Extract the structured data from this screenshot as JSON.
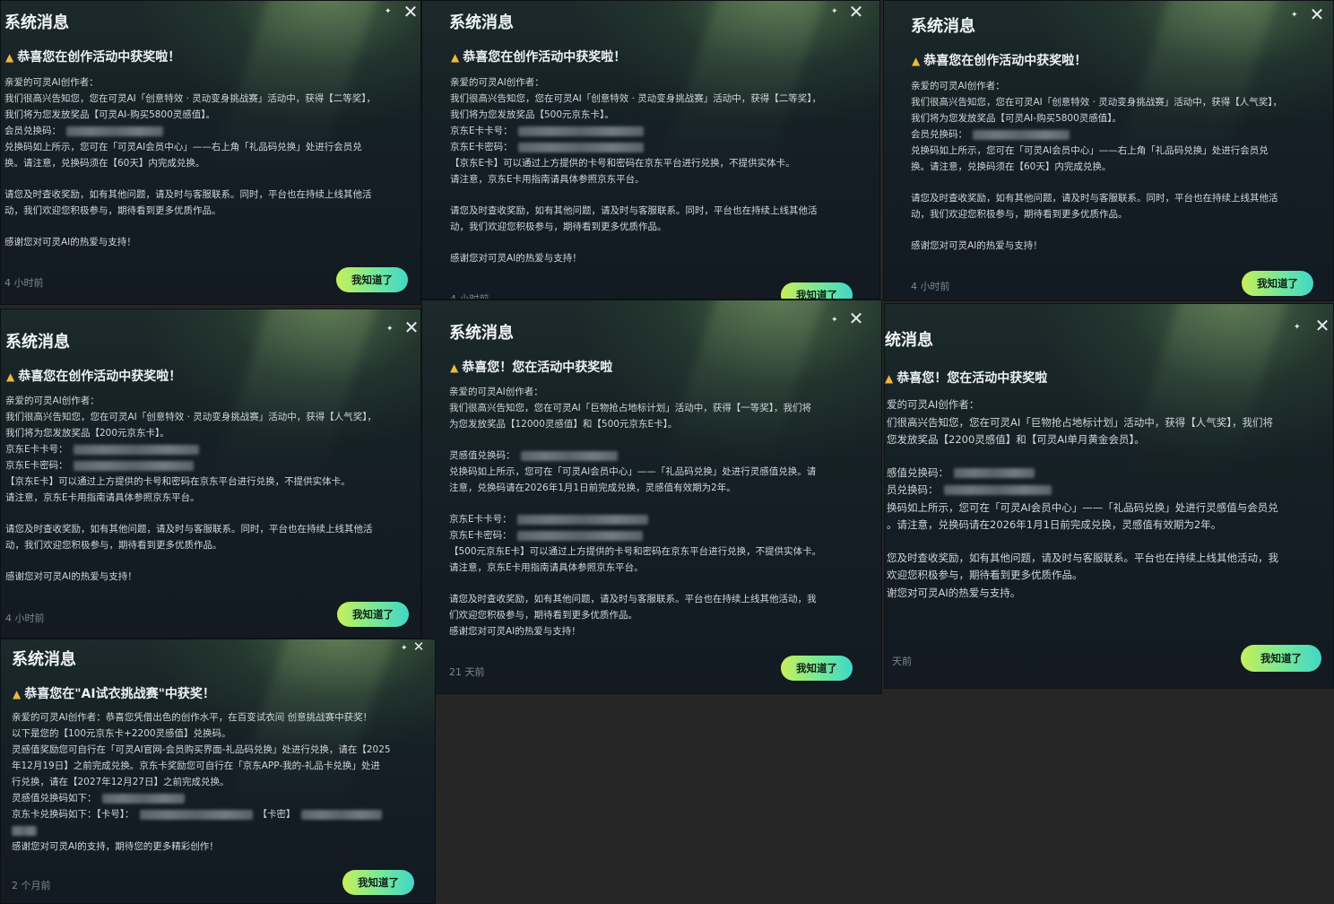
{
  "common": {
    "title": "系统消息",
    "button_label": "我知道了",
    "close_glyph": "✕"
  },
  "cards": [
    {
      "headline": "恭喜您在创作活动中获奖啦！",
      "lines": [
        "亲爱的可灵AI创作者：",
        "我们很高兴告知您，您在可灵AI「创意特效 · 灵动变身挑战赛」活动中，获得【二等奖】，",
        "我们将为您发放奖品【可灵AI-购买5800灵感值】。",
        "会员兑换码：",
        "兑换码如上所示，您可在「可灵AI会员中心」——右上角「礼品码兑换」处进行会员兑",
        "换。请注意，兑换码须在【60天】内完成兑换。",
        "",
        "请您及时查收奖励，如有其他问题，请及时与客服联系。同时，平台也在持续上线其他活",
        "动，我们欢迎您积极参与，期待看到更多优质作品。",
        "",
        "感谢您对可灵AI的热爱与支持！"
      ],
      "time": "4 小时前"
    },
    {
      "headline": "恭喜您在创作活动中获奖啦！",
      "lines": [
        "亲爱的可灵AI创作者：",
        "我们很高兴告知您，您在可灵AI「创意特效 · 灵动变身挑战赛」活动中，获得【二等奖】，",
        "我们将为您发放奖品【500元京东卡】。",
        "京东E卡卡号：",
        "京东E卡密码：",
        "【京东E卡】可以通过上方提供的卡号和密码在京东平台进行兑换，不提供实体卡。",
        "请注意，京东E卡用指南请具体参照京东平台。",
        "",
        "请您及时查收奖励，如有其他问题，请及时与客服联系。同时，平台也在持续上线其他活",
        "动，我们欢迎您积极参与，期待看到更多优质作品。",
        "",
        "感谢您对可灵AI的热爱与支持！"
      ],
      "time": "4 小时前"
    },
    {
      "headline": "恭喜您在创作活动中获奖啦！",
      "lines": [
        "亲爱的可灵AI创作者：",
        "我们很高兴告知您，您在可灵AI「创意特效 · 灵动变身挑战赛」活动中，获得【人气奖】，",
        "我们将为您发放奖品【可灵AI-购买5800灵感值】。",
        "会员兑换码：",
        "兑换码如上所示，您可在「可灵AI会员中心」——右上角「礼品码兑换」处进行会员兑",
        "换。请注意，兑换码须在【60天】内完成兑换。",
        "",
        "请您及时查收奖励，如有其他问题，请及时与客服联系。同时，平台也在持续上线其他活",
        "动，我们欢迎您积极参与，期待看到更多优质作品。",
        "",
        "感谢您对可灵AI的热爱与支持！"
      ],
      "time": "4 小时前"
    },
    {
      "headline": "恭喜您在创作活动中获奖啦！",
      "lines": [
        "亲爱的可灵AI创作者：",
        "我们很高兴告知您，您在可灵AI「创意特效 · 灵动变身挑战赛」活动中，获得【人气奖】，",
        "我们将为您发放奖品【200元京东卡】。",
        "京东E卡卡号：",
        "京东E卡密码：",
        "【京东E卡】可以通过上方提供的卡号和密码在京东平台进行兑换，不提供实体卡。",
        "请注意，京东E卡用指南请具体参照京东平台。",
        "",
        "请您及时查收奖励，如有其他问题，请及时与客服联系。同时，平台也在持续上线其他活",
        "动，我们欢迎您积极参与，期待看到更多优质作品。",
        "",
        "感谢您对可灵AI的热爱与支持！"
      ],
      "time": "4 小时前"
    },
    {
      "headline": "恭喜您！您在活动中获奖啦",
      "lines": [
        "亲爱的可灵AI创作者：",
        "我们很高兴告知您，您在可灵AI「巨物抢占地标计划」活动中，获得【一等奖】，我们将",
        "为您发放奖品【12000灵感值】和【500元京东E卡】。",
        "",
        "灵感值兑换码：",
        "兑换码如上所示，您可在「可灵AI会员中心」——「礼品码兑换」处进行灵感值兑换。请",
        "注意，兑换码请在2026年1月1日前完成兑换，灵感值有效期为2年。",
        "",
        "京东E卡卡号：",
        "京东E卡密码：",
        "【500元京东E卡】可以通过上方提供的卡号和密码在京东平台进行兑换，不提供实体卡。",
        "请注意，京东E卡用指南请具体参照京东平台。",
        "",
        "请您及时查收奖励，如有其他问题，请及时与客服联系。平台也在持续上线其他活动，我",
        "们欢迎您积极参与，期待看到更多优质作品。",
        "感谢您对可灵AI的热爱与支持！"
      ],
      "time": "21 天前"
    },
    {
      "headline": "恭喜您！您在活动中获奖啦",
      "lines": [
        "爱的可灵AI创作者：",
        "们很高兴告知您，您在可灵AI「巨物抢占地标计划」活动中，获得【人气奖】，我们将",
        "您发放奖品【2200灵感值】和【可灵AI单月黄金会员】。",
        "",
        "感值兑换码：",
        "员兑换码：",
        "换码如上所示，您可在「可灵AI会员中心」——「礼品码兑换」处进行灵感值与会员兑",
        "。请注意，兑换码请在2026年1月1日前完成兑换，灵感值有效期为2年。",
        "",
        "您及时查收奖励，如有其他问题，请及时与客服联系。平台也在持续上线其他活动，我",
        "欢迎您积极参与，期待看到更多优质作品。",
        "谢您对可灵AI的热爱与支持。"
      ],
      "time": "天前",
      "title": "统消息"
    },
    {
      "headline": "恭喜您在\"AI试衣挑战赛\"中获奖！",
      "lines": [
        "亲爱的可灵AI创作者：恭喜您凭借出色的创作水平，在百变试衣间 创意挑战赛中获奖！",
        "以下是您的【100元京东卡+2200灵感值】兑换码。",
        "灵感值奖励您可自行在「可灵AI官网-会员购买界面-礼品码兑换」处进行兑换，请在【2025",
        "年12月19日】之前完成兑换。京东卡奖励您可自行在「京东APP-我的-礼品卡兑换」处进",
        "行兑换，请在【2027年12月27日】之前完成兑换。",
        "灵感值兑换码如下：",
        "京东卡兑换码如下：【卡号】：",
        "【卡密】",
        "感谢您对可灵AI的支持，期待您的更多精彩创作！"
      ],
      "time": "2 个月前"
    }
  ],
  "truncated_time": "4 小时前"
}
